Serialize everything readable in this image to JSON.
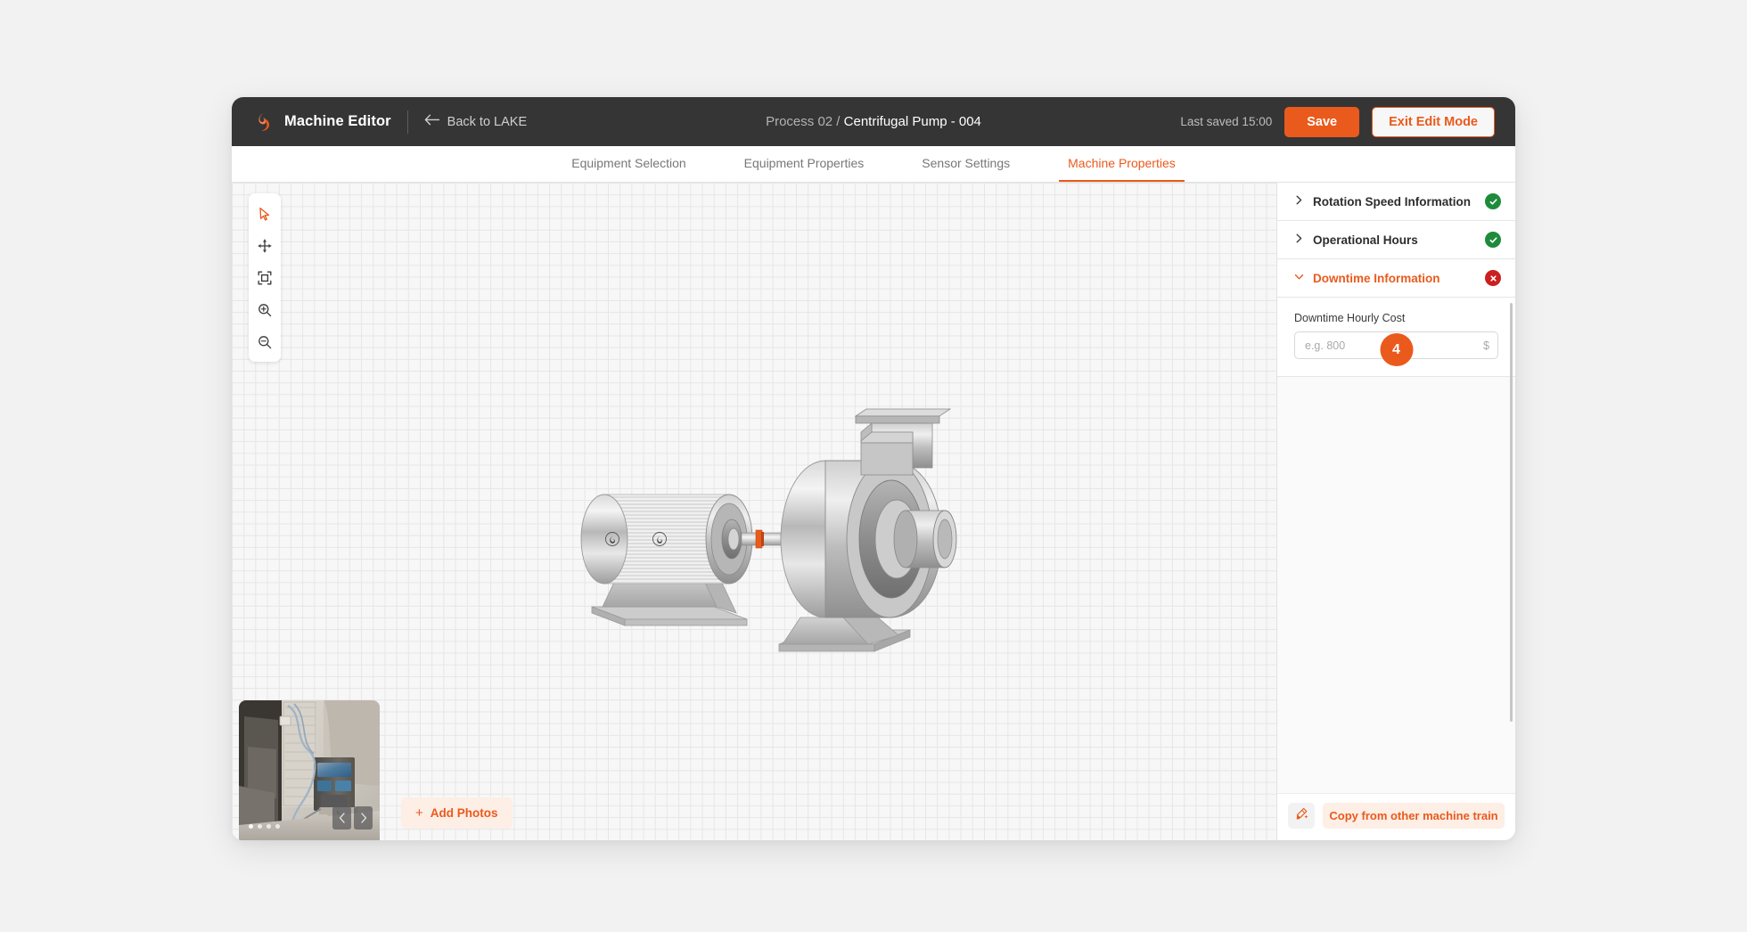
{
  "header": {
    "app_title": "Machine Editor",
    "logo_icon": "flame-logo-icon",
    "back_icon": "arrow-left-icon",
    "back_label": "Back to LAKE",
    "breadcrumb_parent": "Process 02 /",
    "breadcrumb_current": "Centrifugal Pump - 004",
    "last_saved": "Last saved 15:00",
    "save_label": "Save",
    "exit_label": "Exit Edit Mode",
    "accent_color": "#ea5a1c",
    "bar_color": "#353535"
  },
  "tabs": [
    {
      "label": "Equipment Selection",
      "active": false
    },
    {
      "label": "Equipment Properties",
      "active": false
    },
    {
      "label": "Sensor Settings",
      "active": false
    },
    {
      "label": "Machine Properties",
      "active": true
    }
  ],
  "toolbar": {
    "tools": [
      {
        "name": "select-cursor-tool",
        "icon": "cursor-arrow-icon",
        "active": true
      },
      {
        "name": "pan-tool",
        "icon": "move-arrows-icon",
        "active": false
      },
      {
        "name": "fit-to-screen-tool",
        "icon": "fit-frame-icon",
        "active": false
      },
      {
        "name": "zoom-in-tool",
        "icon": "magnifier-plus-icon",
        "active": false
      },
      {
        "name": "zoom-out-tool",
        "icon": "magnifier-minus-icon",
        "active": false
      }
    ]
  },
  "canvas": {
    "illustration": "centrifugal-pump-motor-assembly",
    "photo": {
      "alt": "machine-site-photo",
      "dot_count": 4,
      "active_dot": 0,
      "prev_icon": "chevron-left-icon",
      "next_icon": "chevron-right-icon"
    },
    "add_photos_label": "Add Photos",
    "add_photos_icon": "plus-icon"
  },
  "panel": {
    "sections": [
      {
        "id": "rotation-speed-information",
        "title": "Rotation Speed Information",
        "open": false,
        "status": "complete",
        "status_icon": "check-circle-icon",
        "chevron": "chevron-right-icon"
      },
      {
        "id": "operational-hours",
        "title": "Operational Hours",
        "open": false,
        "status": "complete",
        "status_icon": "check-circle-icon",
        "chevron": "chevron-right-icon"
      },
      {
        "id": "downtime-information",
        "title": "Downtime Information",
        "open": true,
        "status": "error",
        "status_icon": "x-circle-icon",
        "chevron": "chevron-down-icon"
      }
    ],
    "downtime_field": {
      "label": "Downtime Hourly Cost",
      "value": "",
      "placeholder": "e.g. 800",
      "suffix": "$"
    },
    "step_badge": "4",
    "footer": {
      "wand_icon": "magic-wand-icon",
      "copy_label": "Copy from other machine train"
    }
  }
}
